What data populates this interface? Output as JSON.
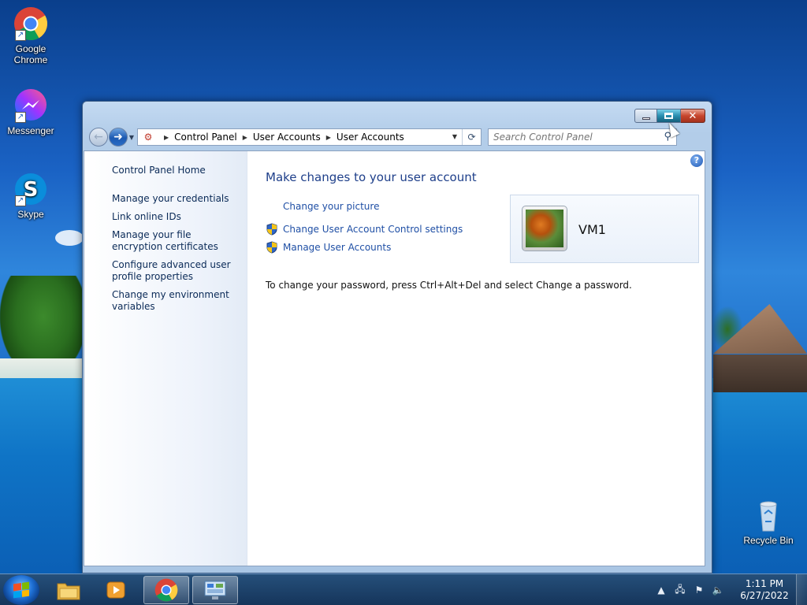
{
  "desktop": {
    "icons": [
      {
        "label": "Google Chrome",
        "icon": "chrome-icon"
      },
      {
        "label": "Messenger",
        "icon": "messenger-icon"
      },
      {
        "label": "Skype",
        "icon": "skype-icon"
      },
      {
        "label": "Recycle Bin",
        "icon": "recycle-bin-icon"
      }
    ]
  },
  "window": {
    "title": "User Accounts",
    "address": {
      "crumbs": [
        "Control Panel",
        "User Accounts",
        "User Accounts"
      ]
    },
    "search": {
      "placeholder": "Search Control Panel"
    },
    "sidebar": {
      "home": "Control Panel Home",
      "links": [
        "Manage your credentials",
        "Link online IDs",
        "Manage your file encryption certificates",
        "Configure advanced user profile properties",
        "Change my environment variables"
      ]
    },
    "main": {
      "heading": "Make changes to your user account",
      "tasks": [
        {
          "label": "Change your picture",
          "shield": false
        },
        {
          "label": "Change User Account Control settings",
          "shield": true
        },
        {
          "label": "Manage User Accounts",
          "shield": true
        }
      ],
      "user": {
        "name": "VM1"
      },
      "password_note": "To change your password, press Ctrl+Alt+Del and select Change a password."
    }
  },
  "taskbar": {
    "pinned": [
      "explorer-icon",
      "media-player-icon",
      "chrome-icon",
      "control-panel-icon"
    ],
    "clock": {
      "time": "1:11 PM",
      "date": "6/27/2022"
    }
  },
  "colors": {
    "link": "#1f4fa5",
    "heading": "#1e3f8a",
    "taskbar": "#1f4570"
  }
}
